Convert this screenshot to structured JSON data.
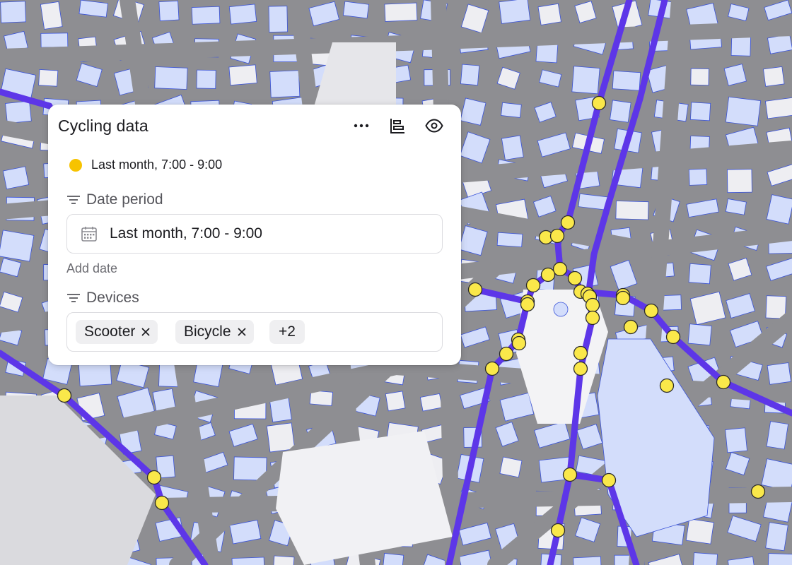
{
  "panel": {
    "title": "Cycling data",
    "icons": {
      "more": "more-horizontal-icon",
      "chart": "bar-chart-icon",
      "visibility": "eye-icon"
    },
    "legend": {
      "label": "Last month, 7:00 - 9:00",
      "color": "#f7c300"
    },
    "date_period": {
      "label": "Date period",
      "icon": "filter-icon",
      "value": "Last month, 7:00 - 9:00",
      "field_icon": "calendar-icon",
      "add_link": "Add date"
    },
    "devices": {
      "label": "Devices",
      "icon": "filter-icon",
      "chips": [
        "Scooter",
        "Bicycle"
      ],
      "chip_remove_icon": "close-icon",
      "more_chip": "+2"
    }
  },
  "colors": {
    "route": "#5d36e8",
    "point_fill": "#fae84a",
    "point_stroke": "#2a2a2a",
    "building_fill": "#d3ddfb",
    "building_stroke": "#3b54d9",
    "road": "#8e8e92",
    "plaza": "#f3f3f5",
    "water": "#d3ddfb"
  }
}
